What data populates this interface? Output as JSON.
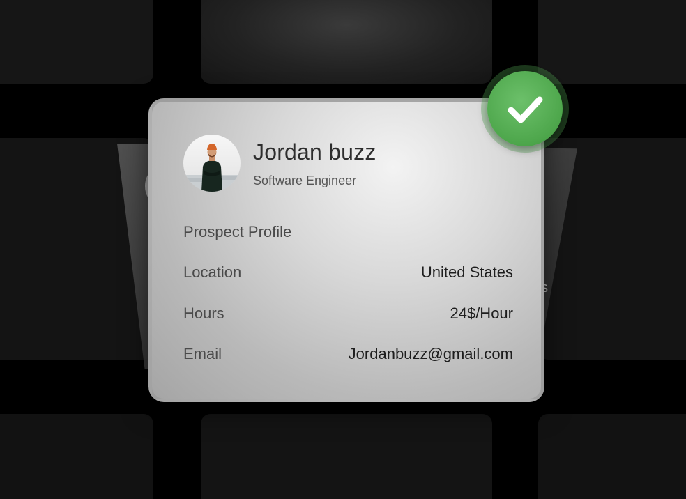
{
  "profile": {
    "name": "Jordan buzz",
    "role": "Software Engineer",
    "avatar_icon": "person-avatar-icon",
    "section_title": "Prospect Profile",
    "fields": [
      {
        "label": "Location",
        "value": "United States"
      },
      {
        "label": "Hours",
        "value": "24$/Hour"
      },
      {
        "label": "Email",
        "value": "Jordanbuzz@gmail.com"
      }
    ]
  },
  "badge": {
    "icon": "checkmark-icon",
    "color": "#4da64b"
  },
  "back_card": {
    "fragment_1": "s",
    "fragment_2": "."
  },
  "colors": {
    "background": "#000000",
    "card": "#d6d6d6",
    "text_primary": "#2d2d2d",
    "text_secondary": "#4a4a4a"
  }
}
